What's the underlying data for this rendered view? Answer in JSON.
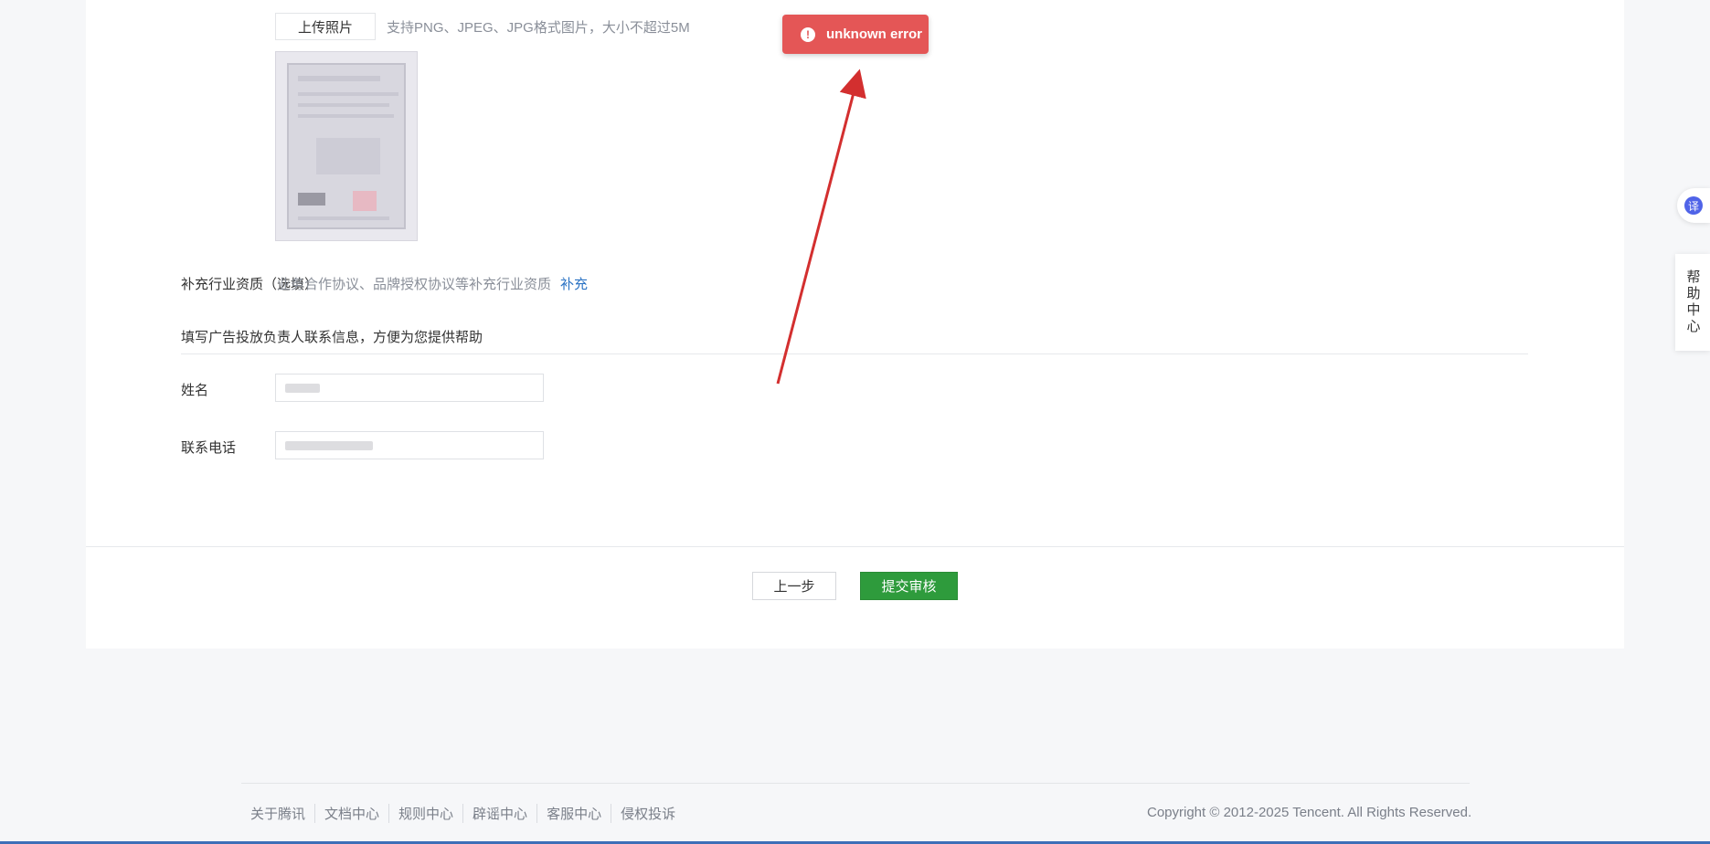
{
  "upload": {
    "button_label": "上传照片",
    "hint": "支持PNG、JPEG、JPG格式图片，大小不超过5M"
  },
  "supplement": {
    "label": "补充行业资质（选填）",
    "description": "业务合作协议、品牌授权协议等补充行业资质",
    "link": "补充"
  },
  "contact": {
    "section_title": "填写广告投放负责人联系信息，方便为您提供帮助",
    "name_label": "姓名",
    "phone_label": "联系电话"
  },
  "actions": {
    "prev_label": "上一步",
    "submit_label": "提交审核"
  },
  "toast": {
    "message": "unknown error",
    "icon": "exclamation-icon",
    "color": "#e45656"
  },
  "sidebar": {
    "translate_icon": "译",
    "help_label": "帮助中心"
  },
  "footer": {
    "links": [
      "关于腾讯",
      "文档中心",
      "规则中心",
      "辟谣中心",
      "客服中心",
      "侵权投诉"
    ],
    "copyright": "Copyright © 2012-2025 Tencent. All Rights Reserved."
  },
  "colors": {
    "submit": "#2e9b3c",
    "link": "#2b73c4",
    "toast": "#e45656",
    "arrow": "#d32f2f"
  }
}
